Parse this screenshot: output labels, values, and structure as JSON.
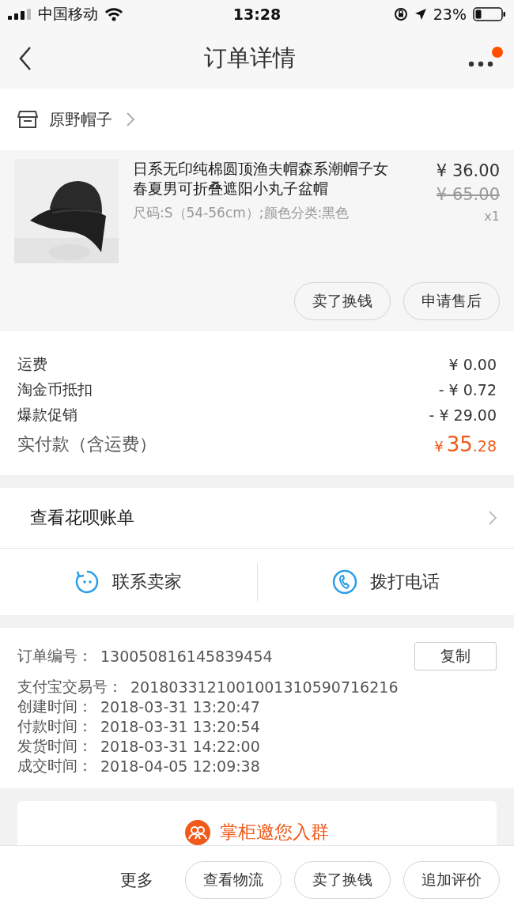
{
  "status_bar": {
    "carrier": "中国移动",
    "time": "13:28",
    "battery_percent": "23%"
  },
  "nav": {
    "title": "订单详情",
    "has_badge": true
  },
  "shop": {
    "name": "原野帽子"
  },
  "product": {
    "kind": "picture",
    "title": "日系无印纯棉圆顶渔夫帽森系潮帽子女春夏男可折叠遮阳小丸子盆帽",
    "sku": "尺码:S（54-56cm）;颜色分类:黑色",
    "price": "¥ 36.00",
    "original_price": "¥ 65.00",
    "quantity": "x1",
    "buttons": [
      "卖了换钱",
      "申请售后"
    ]
  },
  "fees": [
    {
      "label": "运费",
      "value": "¥ 0.00"
    },
    {
      "label": "淘金币抵扣",
      "value": "- ¥ 0.72"
    },
    {
      "label": "爆款促销",
      "value": "- ¥ 29.00"
    }
  ],
  "total": {
    "label": "实付款（含运费）",
    "currency": "¥",
    "integer": "35",
    "decimal": ".28"
  },
  "huabei": {
    "label": "查看花呗账单"
  },
  "contact": [
    {
      "kind": "chat",
      "label": "联系卖家"
    },
    {
      "kind": "phone",
      "label": "拨打电话"
    }
  ],
  "order_info": {
    "copy_button": "复制",
    "rows": [
      {
        "label": "订单编号：",
        "value": "130050816145839454"
      },
      {
        "label": "支付宝交易号：",
        "value": "2018033121001001310590716216"
      },
      {
        "label": "创建时间：",
        "value": "2018-03-31 13:20:47"
      },
      {
        "label": "付款时间：",
        "value": "2018-03-31 13:20:54"
      },
      {
        "label": "发货时间：",
        "value": "2018-03-31 14:22:00"
      },
      {
        "label": "成交时间：",
        "value": "2018-04-05 12:09:38"
      }
    ]
  },
  "invite": {
    "label": "掌柜邀您入群"
  },
  "bottom_bar": {
    "more": "更多",
    "buttons": [
      "查看物流",
      "卖了换钱",
      "追加评价"
    ]
  }
}
